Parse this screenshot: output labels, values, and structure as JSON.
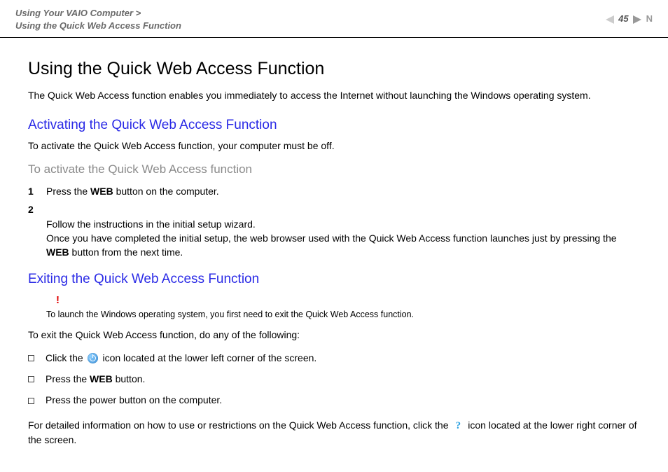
{
  "header": {
    "breadcrumb_line1": "Using Your VAIO Computer >",
    "breadcrumb_line2": "Using the Quick Web Access Function",
    "page_number": "45",
    "letter_n": "N"
  },
  "title": "Using the Quick Web Access Function",
  "intro": "The Quick Web Access function enables you immediately to access the Internet without launching the Windows operating system.",
  "section1": {
    "heading": "Activating the Quick Web Access Function",
    "sub": "To activate the Quick Web Access function, your computer must be off.",
    "procedure_heading": "To activate the Quick Web Access function",
    "steps": [
      {
        "num": "1",
        "pre": "Press the ",
        "bold": "WEB",
        "post": " button on the computer."
      },
      {
        "num": "2",
        "pre": "Follow the instructions in the initial setup wizard.\nOnce you have completed the initial setup, the web browser used with the Quick Web Access function launches just by pressing the ",
        "bold": "WEB",
        "post": " button from the next time."
      }
    ]
  },
  "section2": {
    "heading": "Exiting the Quick Web Access Function",
    "alert_mark": "!",
    "alert_text": "To launch the Windows operating system, you first need to exit the Quick Web Access function.",
    "sub": "To exit the Quick Web Access function, do any of the following:",
    "bullets": {
      "b1_pre": "Click the ",
      "b1_post": " icon located at the lower left corner of the screen.",
      "b2_pre": "Press the ",
      "b2_bold": "WEB",
      "b2_post": " button.",
      "b3": "Press the power button on the computer."
    },
    "footer_pre": "For detailed information on how to use or restrictions on the Quick Web Access function, click the ",
    "footer_help": "?",
    "footer_post": " icon located at the lower right corner of the screen."
  }
}
